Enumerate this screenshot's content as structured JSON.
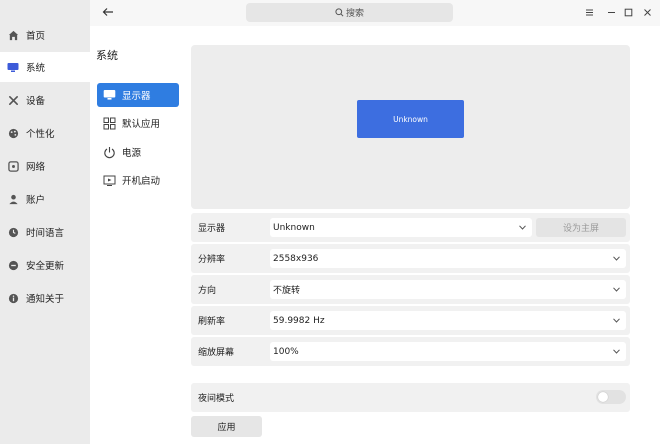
{
  "nav": {
    "items": [
      {
        "label": "首页",
        "icon": "home-icon"
      },
      {
        "label": "系统",
        "icon": "monitor-icon"
      },
      {
        "label": "设备",
        "icon": "tools-icon"
      },
      {
        "label": "个性化",
        "icon": "palette-icon"
      },
      {
        "label": "网络",
        "icon": "network-icon"
      },
      {
        "label": "账户",
        "icon": "user-icon"
      },
      {
        "label": "时间语言",
        "icon": "clock-icon"
      },
      {
        "label": "安全更新",
        "icon": "shield-icon"
      },
      {
        "label": "通知关于",
        "icon": "info-icon"
      }
    ],
    "active_index": 1
  },
  "header": {
    "search_placeholder": "搜索"
  },
  "subpanel": {
    "title": "系统",
    "items": [
      {
        "label": "显示器",
        "icon": "display-icon"
      },
      {
        "label": "默认应用",
        "icon": "apps-grid-icon"
      },
      {
        "label": "电源",
        "icon": "power-icon"
      },
      {
        "label": "开机启动",
        "icon": "startup-icon"
      }
    ],
    "active_index": 0
  },
  "display": {
    "preview_monitor": "Unknown",
    "rows": {
      "monitor": {
        "label": "显示器",
        "value": "Unknown",
        "button": "设为主屏"
      },
      "resolution": {
        "label": "分辨率",
        "value": "2558x936"
      },
      "orientation": {
        "label": "方向",
        "value": "不旋转"
      },
      "refresh": {
        "label": "刷新率",
        "value": "59.9982 Hz"
      },
      "scale": {
        "label": "缩放屏幕",
        "value": "100%"
      }
    },
    "night_mode": {
      "label": "夜间模式",
      "enabled": false
    },
    "apply": "应用"
  },
  "colors": {
    "accent": "#2f7de1",
    "monitor_preview": "#3d6ee0"
  }
}
